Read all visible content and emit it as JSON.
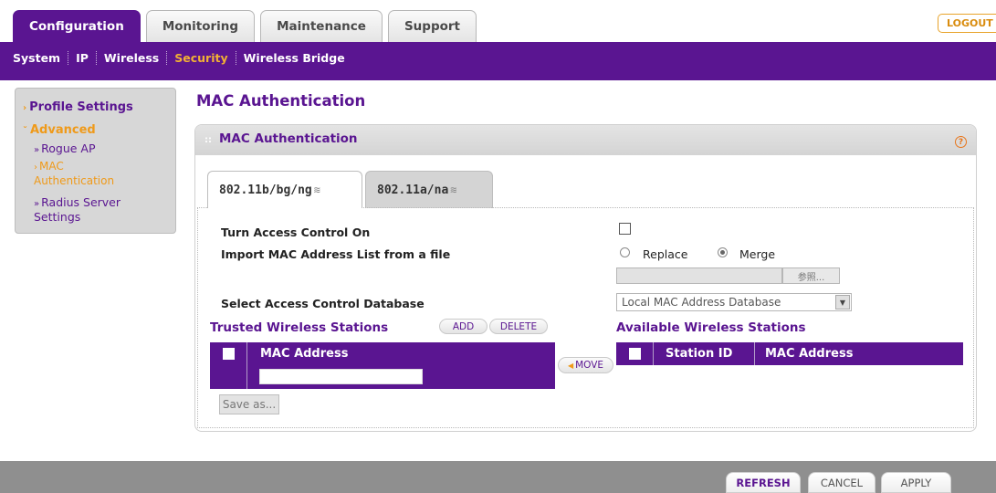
{
  "top_tabs": [
    {
      "label": "Configuration",
      "active": true
    },
    {
      "label": "Monitoring",
      "active": false
    },
    {
      "label": "Maintenance",
      "active": false
    },
    {
      "label": "Support",
      "active": false
    }
  ],
  "logout_label": "LOGOUT",
  "sub_nav": [
    {
      "label": "System",
      "active": false
    },
    {
      "label": "IP",
      "active": false
    },
    {
      "label": "Wireless",
      "active": false
    },
    {
      "label": "Security",
      "active": true
    },
    {
      "label": "Wireless Bridge",
      "active": false
    }
  ],
  "sidebar": {
    "profile_settings": "Profile Settings",
    "advanced": "Advanced",
    "items": [
      {
        "label": "Rogue AP",
        "active": false
      },
      {
        "label": "MAC Authentication",
        "active": true
      },
      {
        "label": "Radius Server Settings",
        "active": false
      }
    ]
  },
  "page_title": "MAC Authentication",
  "panel": {
    "title": "MAC Authentication",
    "help_icon": "?"
  },
  "radio_tabs": [
    {
      "label": "802.11b/bg/ng",
      "active": true
    },
    {
      "label": "802.11a/na",
      "active": false
    }
  ],
  "form": {
    "access_control_label": "Turn Access Control On",
    "access_control_checked": false,
    "import_label": "Import MAC Address List from a file",
    "replace_label": "Replace",
    "merge_label": "Merge",
    "import_mode": "Merge",
    "browse_label": "参照...",
    "database_label": "Select Access Control Database",
    "database_value": "Local MAC Address Database"
  },
  "trusted": {
    "title": "Trusted Wireless Stations",
    "add_label": "ADD",
    "delete_label": "DELETE",
    "column": "MAC Address",
    "input_value": "",
    "save_as_label": "Save as..."
  },
  "move_label": "MOVE",
  "available": {
    "title": "Available Wireless Stations",
    "columns": [
      "Station ID",
      "MAC Address"
    ]
  },
  "footer": {
    "refresh": "REFRESH",
    "cancel": "CANCEL",
    "apply": "APPLY"
  },
  "colors": {
    "brand_purple": "#5a1591",
    "accent_orange": "#ef9a1a",
    "footer_gray": "#8f8f8f"
  }
}
